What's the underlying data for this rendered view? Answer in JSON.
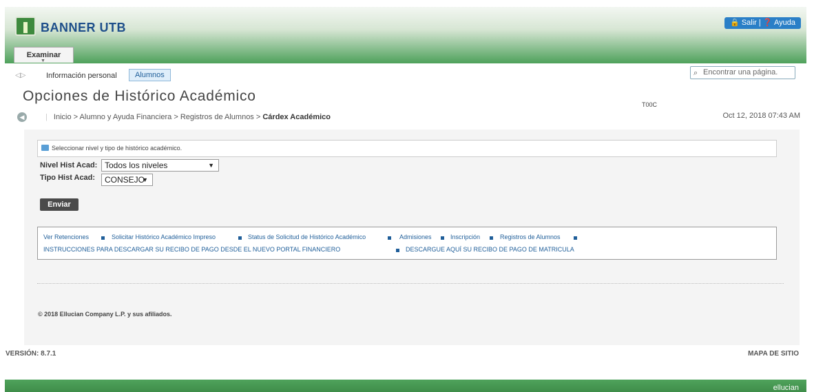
{
  "header": {
    "brand": "BANNER UTB",
    "logout": "Salir",
    "help": "Ayuda",
    "tab": "Examinar"
  },
  "nav": {
    "personal_info": "Información personal",
    "alumnos": "Alumnos",
    "search_placeholder": "Encontrar una página."
  },
  "page": {
    "title": "Opciones de Histórico Académico",
    "user_id": "T00C",
    "datetime": "Oct 12, 2018 07:43 AM"
  },
  "breadcrumb": {
    "items": [
      "Inicio",
      "Alumno y Ayuda Financiera",
      "Registros de Alumnos"
    ],
    "current": "Cárdex Académico"
  },
  "form": {
    "info": "Seleccionar nivel y tipo de histórico académico.",
    "nivel_label": "Nivel Hist Acad:",
    "nivel_value": "Todos los niveles",
    "tipo_label": "Tipo Hist Acad:",
    "tipo_value": "CONSEJO",
    "submit": "Enviar"
  },
  "links": [
    "Ver Retenciones",
    "Solicitar Histórico Académico Impreso",
    "Status de Solicitud de Histórico Académico",
    "Admisiones",
    "Inscripción",
    "Registros de Alumnos",
    "INSTRUCCIONES PARA DESCARGAR SU RECIBO DE PAGO DESDE EL NUEVO PORTAL FINANCIERO",
    "DESCARGUE AQUÍ SU RECIBO DE PAGO DE MATRICULA"
  ],
  "footer": {
    "copyright": "© 2018 Ellucian Company L.P. y sus afiliados.",
    "version": "VERSIÓN: 8.7.1",
    "sitemap": "MAPA DE SITIO",
    "ellucian": "ellucian"
  },
  "colors": {
    "brand_green": "#4ea15b",
    "link_blue": "#1f5e99",
    "brand_text": "#1d4e8a"
  }
}
